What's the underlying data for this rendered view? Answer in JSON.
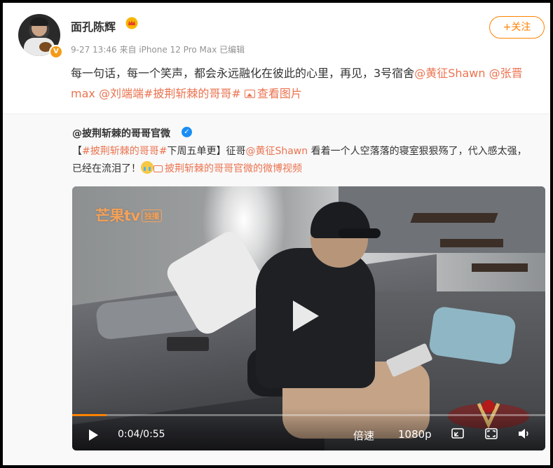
{
  "post": {
    "author": "面孔陈辉",
    "meta": "9-27 13:46  来自 iPhone 12 Pro Max  已编辑",
    "follow_label": "+关注",
    "text_plain1": "每一句话，每一个笑声，都会永远融化在彼此的心里，再见，3号宿舍",
    "mention1": "@黄征Shawn",
    "mention2": "@张晋max",
    "mention3": "@刘端端",
    "hashtag": "#披荆斩棘的哥哥#",
    "view_pic": "查看图片"
  },
  "retweet": {
    "author": "@披荆斩棘的哥哥官微",
    "bracket_open": "【",
    "hashtag": "#披荆斩棘的哥哥#",
    "bracket_rest": "下周五单更】征哥",
    "mention": "@黄征Shawn",
    "text1": " 看着一个人空落落的寝室狠狠殇了，代入感太强，已经在流泪了！",
    "video_link": "披荆斩棘的哥哥官微的微博视频"
  },
  "video": {
    "brand": "芒果tv",
    "brand_tag": "独播",
    "time": "0:04/0:55",
    "speed_label": "倍速",
    "quality_label": "1080p",
    "progress": 0.073,
    "icons": [
      "play-icon",
      "pip-icon",
      "fullscreen-icon",
      "volume-icon"
    ]
  },
  "colors": {
    "accent": "#ff8200",
    "link": "#eb7350",
    "verified": "#1a8df5"
  }
}
